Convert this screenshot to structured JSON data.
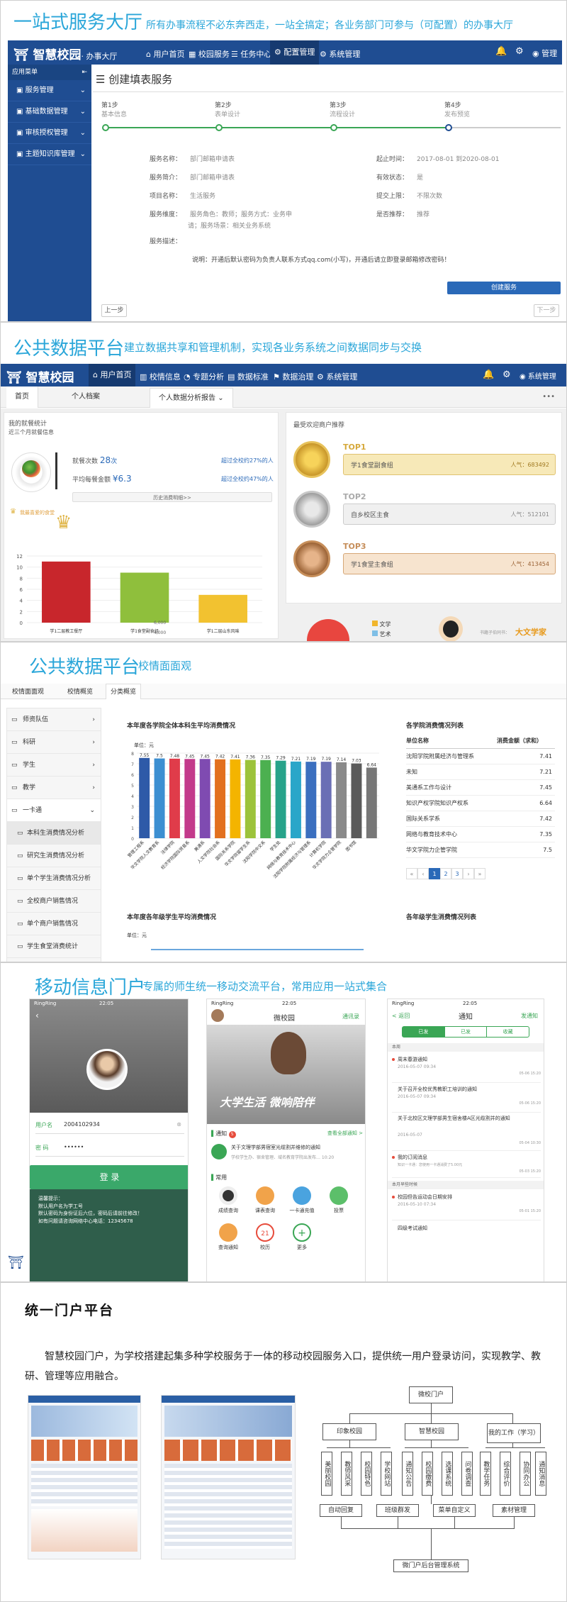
{
  "colors": {
    "primary": "#1f4d92",
    "accent": "#2aa6d9",
    "step": "#3aa655",
    "gold": "#e0b64a"
  },
  "s1": {
    "title": "一站式服务大厅",
    "subtitle": "所有办事流程不必东奔西走，一站全搞定；各业务部门可参与（可配置）的办事大厅",
    "logo": "智慧校园",
    "logo_sub": "· 办事大厅",
    "nav": [
      "用户首页",
      "校园服务",
      "任务中心",
      "配置管理",
      "系统管理"
    ],
    "user": "管理",
    "sidebar_head": "应用菜单",
    "sidebar": [
      "服务管理",
      "基础数据管理",
      "审核授权管理",
      "主题知识库管理"
    ],
    "page_title": "创建填表服务",
    "steps": [
      {
        "n": "第1步",
        "t": "基本信息"
      },
      {
        "n": "第2步",
        "t": "表单设计"
      },
      {
        "n": "第3步",
        "t": "流程设计"
      },
      {
        "n": "第4步",
        "t": "发布预览"
      }
    ],
    "left_fields": [
      {
        "k": "服务名称：",
        "v": "部门邮箱申请表"
      },
      {
        "k": "服务简介：",
        "v": "部门邮箱申请表"
      },
      {
        "k": "项目名称：",
        "v": "生活服务"
      },
      {
        "k": "服务维度：",
        "v": "服务角色：教师；服务方式：业务申"
      },
      {
        "k": "",
        "v": "请；服务场景：相关业务系统"
      },
      {
        "k": "服务描述：",
        "v": ""
      }
    ],
    "right_fields": [
      {
        "k": "起止时间：",
        "v": "2017-08-01 到2020-08-01"
      },
      {
        "k": "有效状态：",
        "v": "是"
      },
      {
        "k": "提交上限：",
        "v": "不限次数"
      },
      {
        "k": "是否推荐：",
        "v": "推荐"
      }
    ],
    "desc": "说明：开通后默认密码为负责人联系方式qq.com(小写)，开通后请立即登录邮箱修改密码！",
    "create_btn": "创建服务",
    "prev_btn": "上一步",
    "next_btn": "下一步"
  },
  "s2": {
    "title": "公共数据平台",
    "subtitle": "建立数据共享和管理机制，实现各业务系统之间数据同步与交换",
    "logo": "智慧校园",
    "nav": [
      "用户首页",
      "校情信息",
      "专题分析",
      "数据标准",
      "数据治理",
      "系统管理"
    ],
    "user": "系统管理",
    "tabs": [
      "首页",
      "个人档案",
      "个人数据分析报告"
    ],
    "more": "•••",
    "card_title": "我的就餐统计",
    "card_sub": "近三个月就餐信息",
    "stats": [
      {
        "k": "就餐次数",
        "v": "28",
        "u": "次",
        "r": "超过全校约27%的人"
      },
      {
        "k": "平均每餐金额",
        "v": "¥6.3",
        "u": "",
        "r": "超过全校约47%的人"
      }
    ],
    "history_btn": "历史消费明细>>",
    "fav_label": "我最喜爱的食堂",
    "chart_yticks": [
      "12",
      "10",
      "8",
      "6",
      "4",
      "2",
      "0"
    ],
    "recommend_title": "最受欢迎商户推荐",
    "tops": [
      {
        "rank": "TOP1",
        "name": "学1食堂副食组",
        "pop": "人气：683492"
      },
      {
        "rank": "TOP2",
        "name": "自乡校区主食",
        "pop": "人气：512101"
      },
      {
        "rank": "TOP3",
        "name": "学1食堂主食组",
        "pop": "人气：413454"
      }
    ],
    "legend": [
      "文学",
      "艺术"
    ],
    "bottom_ticks": [
      "6,000",
      "4,000"
    ],
    "ad": "大文学家",
    "ad_pre": "书籍子伯同书："
  },
  "chart_dining": {
    "type": "bar",
    "categories": [
      "学1二层教工餐厅",
      "学1食堂副食组",
      "学1二层山东风味"
    ],
    "values": [
      11,
      9,
      5
    ],
    "ylim": [
      0,
      12
    ]
  },
  "s3": {
    "title": "公共数据平台",
    "subtitle": "校情面面观",
    "tabs": [
      "校情面面观",
      "校情概览",
      "分类概览"
    ],
    "tree": [
      "师资队伍",
      "科研",
      "学生",
      "教学",
      "一卡通",
      "本科生消费情况分析",
      "研究生消费情况分析",
      "单个学生消费情况分析",
      "全校商户销售情况",
      "单个商户销售情况",
      "学生食堂消费统计"
    ],
    "chart_title": "本年度各学院全体本科生平均消费情况",
    "unit": "单位：元",
    "table_title": "各学院消费情况列表",
    "table_head": [
      "单位名称",
      "消费金额（求和）"
    ],
    "table_rows": [
      [
        "沈阳学院附属经济与管理系",
        "7.41"
      ],
      [
        "未知",
        "7.21"
      ],
      [
        "美通系工作与设计",
        "7.45"
      ],
      [
        "知识产权学院知识产权系",
        "6.64"
      ],
      [
        "国际关系学系",
        "7.42"
      ],
      [
        "网络与教育技术中心",
        "7.35"
      ],
      [
        "华文学院力企管学院",
        "7.5"
      ]
    ],
    "pager": [
      "«",
      "‹",
      "1",
      "2",
      "3",
      "›",
      "»"
    ],
    "chart2_title": "本年度各年级学生平均消费情况",
    "chart2_unit": "单位：元",
    "table2_title": "各年级学生消费情况列表"
  },
  "chart_college": {
    "type": "bar",
    "categories": [
      "管理工程系",
      "华文学院人文教育系",
      "法律学院",
      "经济学院国际贸易系",
      "美通系",
      "人文学院社会系",
      "国际关系学院",
      "华文学院留学生系",
      "沈阳学院中文系",
      "学生处",
      "网络与教育技术中心",
      "沈阳学院附属经济与管理系",
      "计算机学院",
      "华文学院力企管学院",
      "图书馆"
    ],
    "values": [
      7.55,
      7.5,
      7.48,
      7.45,
      7.45,
      7.42,
      7.41,
      7.36,
      7.35,
      7.29,
      7.21,
      7.19,
      7.19,
      7.14,
      7.03,
      6.64
    ],
    "value_labels": [
      "7.55",
      "7.5",
      "7.48",
      "7.45",
      "7.45",
      "7.42",
      "7.41",
      "7.36",
      "7.35",
      "7.29",
      "7.21",
      "7.19",
      "7.19",
      "7.14",
      "7.03",
      "6.64"
    ],
    "yticks": [
      "8",
      "7",
      "6",
      "5",
      "4",
      "3",
      "2",
      "1",
      "0"
    ],
    "ylim": [
      0,
      8
    ]
  },
  "s4": {
    "title": "移动信息门户",
    "subtitle": "专属的师生统一移动交流平台，常用应用一站式集合",
    "p1": {
      "carrier": "RingRing",
      "time": "22:05",
      "user_label": "用户名",
      "user_val": "2004102934",
      "pwd_label": "密 码",
      "pwd_val": "••••••",
      "login": "登 录",
      "tips": [
        "温馨提示：",
        "默认用户名为学工号",
        "默认密码为身份证后六位，密码后请前往修改！",
        "如有问题请咨询网络中心电话：12345678"
      ]
    },
    "p2": {
      "carrier": "RingRing",
      "time": "22:05",
      "title": "微校园",
      "right": "通讯录",
      "banner": "大学生活 微响陪伴",
      "notice_label": "通知",
      "notice_badge": "5",
      "notice_more": "查看全部通知 >",
      "notice_item": "关于文理学部男宿室光缆割并维修的通知",
      "notice_meta": "学校学生办、宿舍管理、域名教育学院出发布… 10:20",
      "common": "常用",
      "apps": [
        "成绩查询",
        "课表查询",
        "一卡通充值",
        "投票",
        "查询通知",
        "校历",
        "更多"
      ],
      "cal_num": "21"
    },
    "p3": {
      "carrier": "RingRing",
      "time": "22:05",
      "back": "< 返回",
      "title": "通知",
      "right": "发通知",
      "tabs": [
        "已发",
        "已发",
        "收藏"
      ],
      "groups": [
        {
          "label": "本周",
          "items": [
            {
              "title": "周末春游通知",
              "date": "2016-05-07 09:34",
              "time": "05-06 15:20"
            },
            {
              "title": "关于召开全校优秀教职工培训的通知",
              "date": "2016-05-07 09:34",
              "time": "05-06 15:20"
            },
            {
              "title": "关于北校区文理学部男生宿舍楼A区光缆割并的通知",
              "date": "2016-05-07",
              "time": "05-04 10:30"
            },
            {
              "title": "我的订阅消息",
              "date": "知识一卡通：您使用一卡通消费了5.00元",
              "time": "05-03 15:20"
            }
          ]
        },
        {
          "label": "本月早些时候",
          "items": [
            {
              "title": "校园但告运动会日期安排",
              "date": "2016-05-10 07:34",
              "time": "05-01 15:20"
            },
            {
              "title": "四级考试通知",
              "date": "",
              "time": ""
            }
          ]
        }
      ]
    }
  },
  "s5": {
    "title": "统一门户平台",
    "body": "智慧校园门户，为学校搭建起集多种学校服务于一体的移动校园服务入口，提供统一用户登录访问，实现教学、教研、管理等应用融合。",
    "org": {
      "root": "微校门户",
      "l2": [
        "印象校园",
        "智慧校园",
        "我的工作（学习）"
      ],
      "l3": [
        "美丽校园",
        "教师风采",
        "校园特色",
        "学校网站",
        "通知公告",
        "校园缴费",
        "选课系统",
        "问卷调查",
        "教学任务",
        "综合评价",
        "协同办公",
        "通知消息"
      ],
      "l4": [
        "自动回复",
        "班级群发",
        "菜单自定义",
        "素材管理"
      ],
      "bottom": "微门户后台管理系统"
    }
  }
}
